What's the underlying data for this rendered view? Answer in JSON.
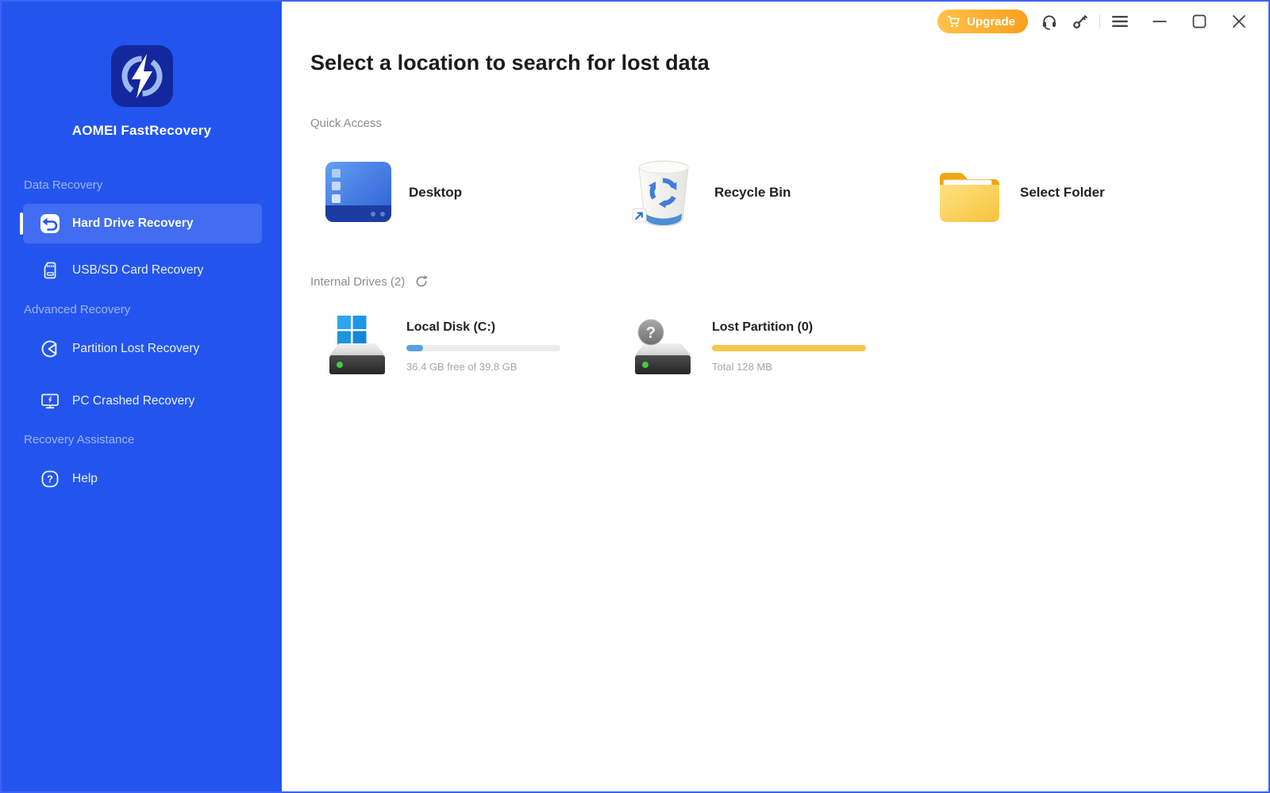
{
  "app": {
    "name": "AOMEI FastRecovery"
  },
  "titlebar": {
    "upgrade_label": "Upgrade",
    "icons": [
      "cart-icon",
      "headset-icon",
      "key-icon",
      "menu-icon",
      "minimize-icon",
      "maximize-icon",
      "close-icon"
    ]
  },
  "sidebar": {
    "sections": [
      {
        "label": "Data Recovery",
        "items": [
          {
            "label": "Hard Drive Recovery",
            "icon": "undo-arrow-icon",
            "active": true
          },
          {
            "label": "USB/SD Card Recovery",
            "icon": "sd-card-icon",
            "active": false
          }
        ]
      },
      {
        "label": "Advanced Recovery",
        "items": [
          {
            "label": "Partition Lost Recovery",
            "icon": "partition-pie-icon",
            "active": false
          },
          {
            "label": "PC Crashed Recovery",
            "icon": "pc-crash-icon",
            "active": false
          }
        ]
      },
      {
        "label": "Recovery Assistance",
        "items": [
          {
            "label": "Help",
            "icon": "help-icon",
            "active": false
          }
        ]
      }
    ]
  },
  "main": {
    "title": "Select a location to search for lost data",
    "quick_access": {
      "label": "Quick Access",
      "items": [
        {
          "label": "Desktop",
          "icon": "desktop-icon"
        },
        {
          "label": "Recycle Bin",
          "icon": "recycle-bin-icon"
        },
        {
          "label": "Select Folder",
          "icon": "folder-icon"
        }
      ]
    },
    "internal_drives": {
      "label": "Internal Drives (2)",
      "refresh_icon": "refresh-icon",
      "drives": [
        {
          "name": "Local Disk (C:)",
          "detail": "36.4 GB free of 39.8 GB",
          "bar_percent": 11,
          "bar_color": "#57A0E8",
          "icon": "hard-drive-windows-icon"
        },
        {
          "name": "Lost Partition (0)",
          "detail": "Total 128 MB",
          "bar_percent": 100,
          "bar_color": "#F7C64A",
          "icon": "hard-drive-question-icon",
          "badge_glyph": "?"
        }
      ]
    }
  },
  "colors": {
    "sidebar": "#2355EE",
    "window_border": "#3A62F3",
    "upgrade_gradient_start": "#FFC24A",
    "upgrade_gradient_end": "#F8A01E",
    "disk_bar_blue": "#57A0E8",
    "disk_bar_yellow": "#F7C64A"
  }
}
